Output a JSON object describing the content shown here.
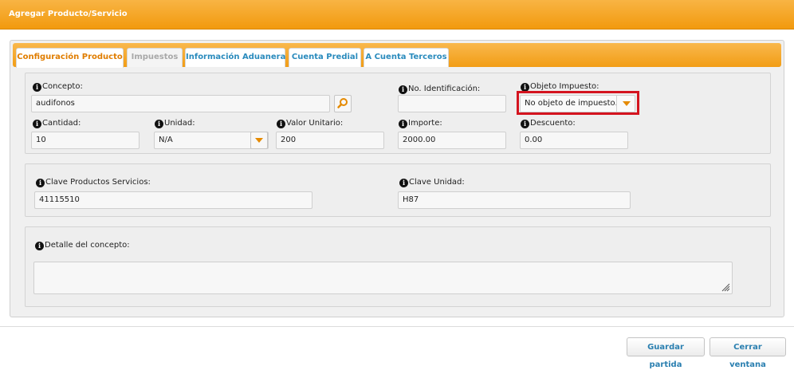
{
  "window": {
    "title": "Agregar Producto/Servicio"
  },
  "tabs": [
    {
      "label": "Configuración Producto",
      "state": "active"
    },
    {
      "label": "Impuestos",
      "state": "disabled"
    },
    {
      "label": "Información Aduanera",
      "state": "normal"
    },
    {
      "label": "Cuenta Predial",
      "state": "normal"
    },
    {
      "label": "A Cuenta Terceros",
      "state": "normal"
    }
  ],
  "product": {
    "concepto": {
      "label": "Concepto:",
      "value": "audifonos"
    },
    "no_identificacion": {
      "label": "No. Identificación:",
      "value": ""
    },
    "objeto_impuesto": {
      "label": "Objeto Impuesto:",
      "value": "No objeto de impuesto."
    },
    "cantidad": {
      "label": "Cantidad:",
      "value": "10"
    },
    "unidad": {
      "label": "Unidad:",
      "value": "N/A"
    },
    "valor_unitario": {
      "label": "Valor Unitario:",
      "value": "200"
    },
    "importe": {
      "label": "Importe:",
      "value": "2000.00"
    },
    "descuento": {
      "label": "Descuento:",
      "value": "0.00"
    }
  },
  "claves": {
    "productos_servicios": {
      "label": "Clave Productos Servicios:",
      "value": "41115510"
    },
    "unidad": {
      "label": "Clave Unidad:",
      "value": "H87"
    }
  },
  "detalle": {
    "label": "Detalle del concepto:",
    "value": ""
  },
  "buttons": {
    "save": "Guardar partida",
    "close": "Cerrar ventana"
  },
  "icons": {
    "info": "info-icon",
    "search": "magnifier-icon",
    "dropdown": "chevron-down-icon",
    "resize": "resize-grip-icon"
  },
  "colors": {
    "header_orange": "#f29a0e",
    "tab_active_text": "#e07d00",
    "link_blue": "#2a8bbd",
    "highlight_red": "#d4141f"
  }
}
